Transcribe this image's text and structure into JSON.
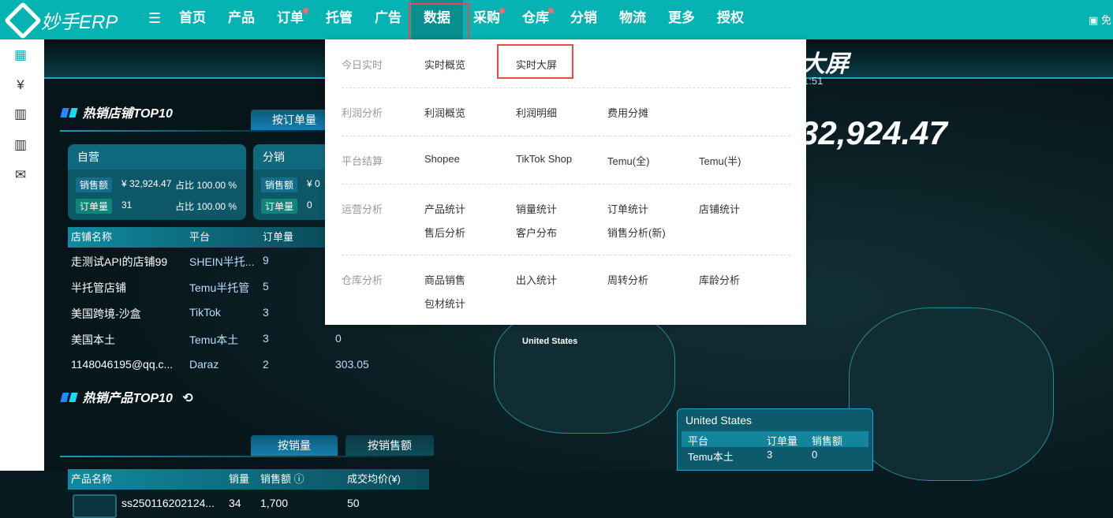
{
  "app": {
    "name": "妙手ERP",
    "right_label": "免"
  },
  "nav": [
    {
      "label": "首页",
      "dot": false
    },
    {
      "label": "产品",
      "dot": false
    },
    {
      "label": "订单",
      "dot": true
    },
    {
      "label": "托管",
      "dot": false
    },
    {
      "label": "广告",
      "dot": false
    },
    {
      "label": "数据",
      "dot": false,
      "active": true
    },
    {
      "label": "采购",
      "dot": true
    },
    {
      "label": "仓库",
      "dot": true
    },
    {
      "label": "分销",
      "dot": false
    },
    {
      "label": "物流",
      "dot": false
    },
    {
      "label": "更多",
      "dot": false
    },
    {
      "label": "授权",
      "dot": false
    }
  ],
  "sidebar": [
    "calendar-clock-icon",
    "yuan-cycle-icon",
    "bar-chart-icon",
    "bar-chart-icon-2",
    "inbox-chart-icon"
  ],
  "dashboard": {
    "title": "大屏",
    "time": "1:51",
    "total_sales": "32,924.47",
    "store_section": {
      "title": "热销店铺TOP10",
      "tab": "按订单量",
      "self": {
        "title": "自营",
        "sales_tag": "销售额",
        "sales": "¥ 32,924.47",
        "sales_ratio": "占比 100.00 %",
        "orders_tag": "订单量",
        "orders": "31",
        "orders_ratio": "占比 100.00 %"
      },
      "dist": {
        "title": "分销",
        "sales_tag": "销售额",
        "sales": "¥ 0",
        "orders_tag": "订单量",
        "orders": "0"
      },
      "columns": [
        "店铺名称",
        "平台",
        "订单量"
      ],
      "rows": [
        [
          "走测试API的店铺99",
          "SHEIN半托...",
          "9",
          ""
        ],
        [
          "半托管店铺",
          "Temu半托管",
          "5",
          ""
        ],
        [
          "美国跨境-沙盒",
          "TikTok",
          "3",
          ""
        ],
        [
          "美国本土",
          "Temu本土",
          "3",
          "0"
        ],
        [
          "1148046195@qq.c...",
          "Daraz",
          "2",
          "303.05"
        ]
      ]
    },
    "product_section": {
      "title": "热销产品TOP10",
      "tabs": [
        "按销量",
        "按销售额"
      ],
      "columns": [
        "产品名称",
        "销量",
        "销售额",
        "成交均价(¥)"
      ],
      "rows": [
        [
          "ss250116202124...",
          "34",
          "1,700",
          "50"
        ]
      ]
    },
    "map": {
      "country_label": "United States",
      "popup": {
        "title": "United States",
        "columns": [
          "平台",
          "订单量",
          "销售额"
        ],
        "rows": [
          [
            "Temu本土",
            "3",
            "0"
          ]
        ]
      }
    }
  },
  "dropdown": {
    "groups": [
      {
        "label": "今日实时",
        "items": [
          "实时概览",
          "实时大屏"
        ]
      },
      {
        "label": "利润分析",
        "items": [
          "利润概览",
          "利润明细",
          "费用分摊"
        ]
      },
      {
        "label": "平台结算",
        "items": [
          "Shopee",
          "TikTok Shop",
          "Temu(全)",
          "Temu(半)"
        ]
      },
      {
        "label": "运营分析",
        "items": [
          "产品统计",
          "销量统计",
          "订单统计",
          "店铺统计",
          "售后分析",
          "客户分布",
          "销售分析(新)"
        ]
      },
      {
        "label": "仓库分析",
        "items": [
          "商品销售",
          "出入统计",
          "周转分析",
          "库龄分析",
          "包材统计"
        ]
      }
    ]
  }
}
